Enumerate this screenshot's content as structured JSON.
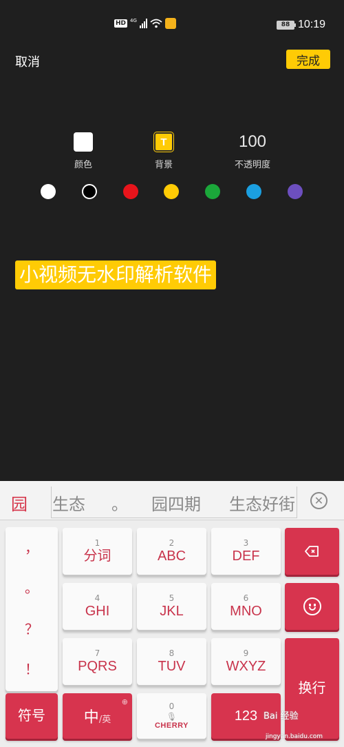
{
  "status_bar": {
    "hd": "HD",
    "network": "4G",
    "battery": "88",
    "time": "10:19"
  },
  "header": {
    "cancel_label": "取消",
    "done_label": "完成"
  },
  "options": {
    "color_label": "颜色",
    "background_label": "背景",
    "background_icon_text": "T",
    "opacity_value": "100",
    "opacity_label": "不透明度"
  },
  "palette": [
    "#ffffff",
    "#000000",
    "#e8141b",
    "#ffcb05",
    "#1ba73a",
    "#1b9fe0",
    "#6d4fbf"
  ],
  "text_preview": "小视频无水印解析软件",
  "keyboard": {
    "candidates": [
      "园",
      "生态",
      "。",
      "园四期",
      "生态好街"
    ],
    "punctuation": [
      "，",
      "。",
      "？",
      "！"
    ],
    "keys": [
      {
        "num": "1",
        "label": "分词"
      },
      {
        "num": "2",
        "label": "ABC"
      },
      {
        "num": "3",
        "label": "DEF"
      },
      {
        "num": "4",
        "label": "GHI"
      },
      {
        "num": "5",
        "label": "JKL"
      },
      {
        "num": "6",
        "label": "MNO"
      },
      {
        "num": "7",
        "label": "PQRS"
      },
      {
        "num": "8",
        "label": "TUV"
      },
      {
        "num": "9",
        "label": "WXYZ"
      }
    ],
    "symbol_label": "符号",
    "lang_main": "中",
    "lang_alt": "/英",
    "space_num": "0",
    "space_brand": "CHERRY",
    "numbers_label": "123",
    "enter_label": "换行"
  },
  "watermark": {
    "text": "Bai 经验",
    "sub": "jingyan.baidu.com"
  }
}
